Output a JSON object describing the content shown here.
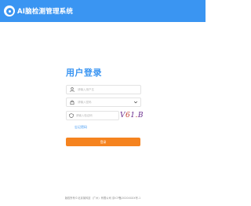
{
  "header": {
    "title": "AI脑检测管理系统",
    "icon": "logo-icon",
    "background": "#3a95f2"
  },
  "login": {
    "heading": "用户登录",
    "username_placeholder": "请输入用户名",
    "password_placeholder": "请输入密码",
    "captcha_placeholder": "请输入验证码",
    "captcha_text": [
      "V",
      "6",
      "1",
      ".",
      "B"
    ],
    "forgot_label": "忘记密码",
    "submit_label": "登录",
    "accent": "#3a95f2",
    "button_color": "#f5831f"
  },
  "footer": {
    "text": "版权所有©北京某科技（广州）有限公司  京ICP备2020XXXX号-1"
  }
}
